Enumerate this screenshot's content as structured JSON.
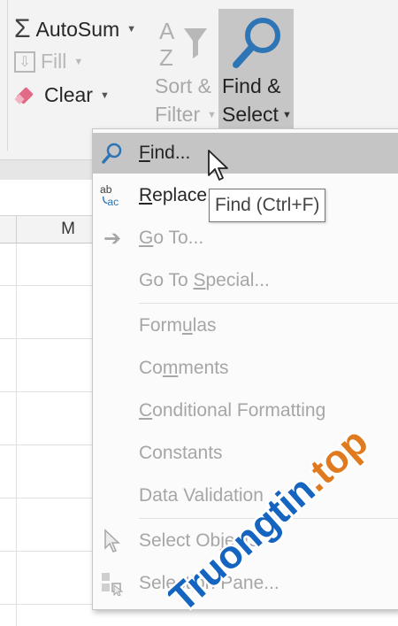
{
  "ribbon": {
    "autosum": "AutoSum",
    "fill": "Fill",
    "clear": "Clear",
    "sort_line1": "Sort &",
    "sort_line2": "Filter",
    "find_line1": "Find &",
    "find_line2": "Select"
  },
  "sheet": {
    "column": "M"
  },
  "menu": {
    "items": [
      {
        "label": "Find...",
        "icon": "magnifier-icon",
        "enabled": true,
        "highlighted": true,
        "underline": "F"
      },
      {
        "label": "Replace...",
        "icon": "replace-icon",
        "enabled": true,
        "underline": "R"
      },
      {
        "label": "Go To...",
        "icon": "arrow-right-icon",
        "enabled": false,
        "underline": "G"
      },
      {
        "label": "Go To Special...",
        "enabled": false,
        "underline": "S"
      },
      {
        "label": "Formulas",
        "enabled": false,
        "underline": "u"
      },
      {
        "label": "Comments",
        "enabled": false,
        "underline": "m"
      },
      {
        "label": "Conditional Formatting",
        "enabled": false,
        "underline": "C"
      },
      {
        "label": "Constants",
        "enabled": false
      },
      {
        "label": "Data Validation",
        "enabled": false
      },
      {
        "label": "Select Objects",
        "icon": "pointer-icon",
        "enabled": false
      },
      {
        "label": "Selection Pane...",
        "icon": "selection-pane-icon",
        "enabled": false
      }
    ]
  },
  "tooltip": "Find (Ctrl+F)",
  "watermark": "Truongtin.top",
  "colors": {
    "accent": "#2e75b6",
    "highlight": "#c5c5c5",
    "watermark_blue": "#1565c0",
    "watermark_orange": "#e07a1f"
  }
}
